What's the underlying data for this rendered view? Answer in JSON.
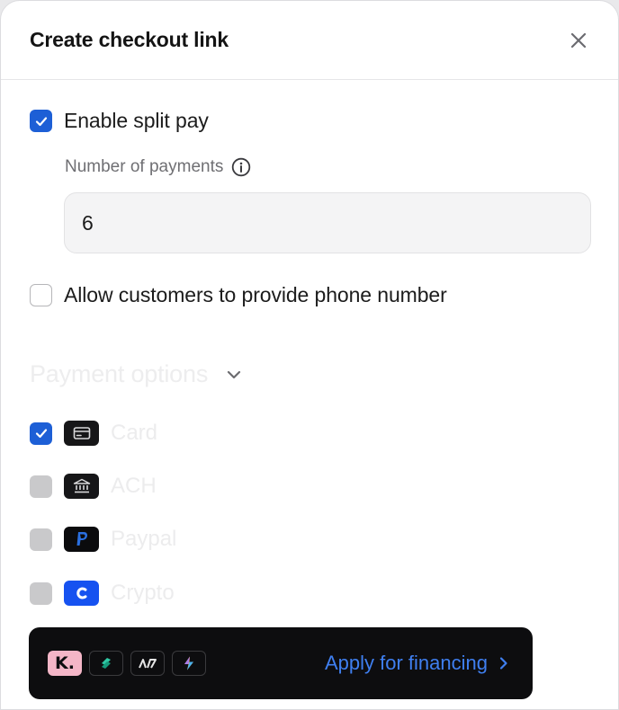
{
  "modal": {
    "title": "Create checkout link"
  },
  "split_pay": {
    "label": "Enable split pay",
    "checked": true,
    "number_of_payments_label": "Number of payments",
    "number_of_payments_value": "6"
  },
  "phone": {
    "label": "Allow customers to provide phone number",
    "checked": false
  },
  "payment_options": {
    "title": "Payment options",
    "items": [
      {
        "label": "Card",
        "checked": true,
        "icon": "card-icon"
      },
      {
        "label": "ACH",
        "checked": false,
        "icon": "bank-icon"
      },
      {
        "label": "Paypal",
        "checked": false,
        "icon": "paypal-icon"
      },
      {
        "label": "Crypto",
        "checked": false,
        "icon": "crypto-icon"
      }
    ]
  },
  "financing": {
    "klarna_letter": "K.",
    "apply_label": "Apply for financing"
  },
  "colors": {
    "accent": "#1d5fd6",
    "link": "#3f7ff0",
    "financing_bg": "#0d0d0f",
    "klarna": "#f4b6c7",
    "muted_text": "#ececed"
  }
}
